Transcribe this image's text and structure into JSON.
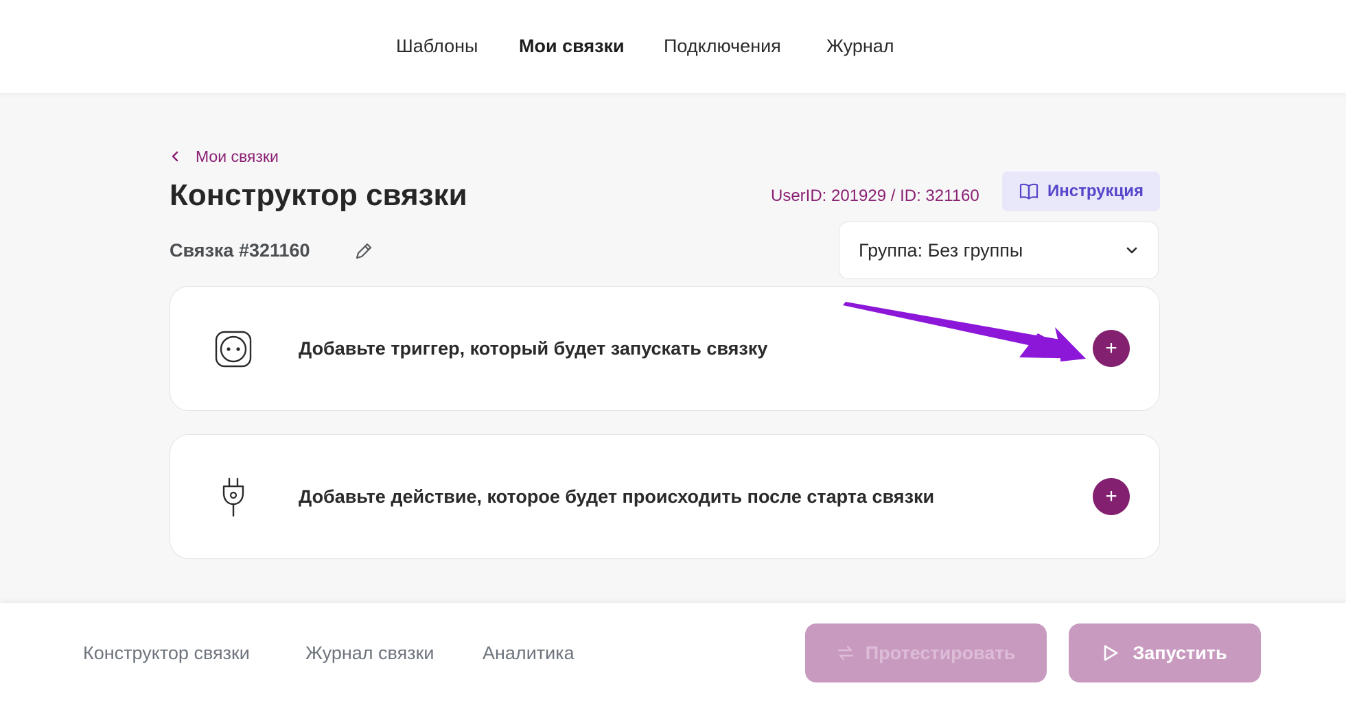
{
  "top_nav": {
    "items": [
      {
        "label": "Шаблоны",
        "active": false
      },
      {
        "label": "Мои связки",
        "active": true
      },
      {
        "label": "Подключения",
        "active": false
      },
      {
        "label": "Журнал",
        "active": false
      }
    ]
  },
  "breadcrumb": {
    "label": "Мои связки",
    "icon": "chevron-left-icon"
  },
  "page": {
    "title": "Конструктор связки",
    "user_id_text": "UserID: 201929 / ID: 321160",
    "instruction_label": "Инструкция",
    "instruction_icon": "book-icon",
    "link_name": "Связка #321160",
    "edit_icon": "pencil-icon"
  },
  "group_select": {
    "value": "Группа: Без группы",
    "icon": "chevron-down-icon"
  },
  "steps": [
    {
      "icon": "socket-icon",
      "label": "Добавьте триггер, который будет запускать связку",
      "add_symbol": "+"
    },
    {
      "icon": "plug-icon",
      "label": "Добавьте действие, которое будет происходить после старта связки",
      "add_symbol": "+"
    }
  ],
  "annotation": {
    "icon": "arrow-icon",
    "color": "#8c17d8"
  },
  "bottom_bar": {
    "tabs": [
      {
        "label": "Конструктор связки"
      },
      {
        "label": "Журнал связки"
      },
      {
        "label": "Аналитика"
      }
    ],
    "test_button": {
      "label": "Протестировать",
      "icon": "swap-arrows-icon",
      "disabled": true
    },
    "run_button": {
      "label": "Запустить",
      "icon": "play-icon"
    }
  },
  "colors": {
    "accent": "#83206f",
    "accent_text": "#8a1f73",
    "instruction_bg": "#e9e8fb",
    "instruction_text": "#5546c9",
    "button_muted": "#c99ac0"
  }
}
